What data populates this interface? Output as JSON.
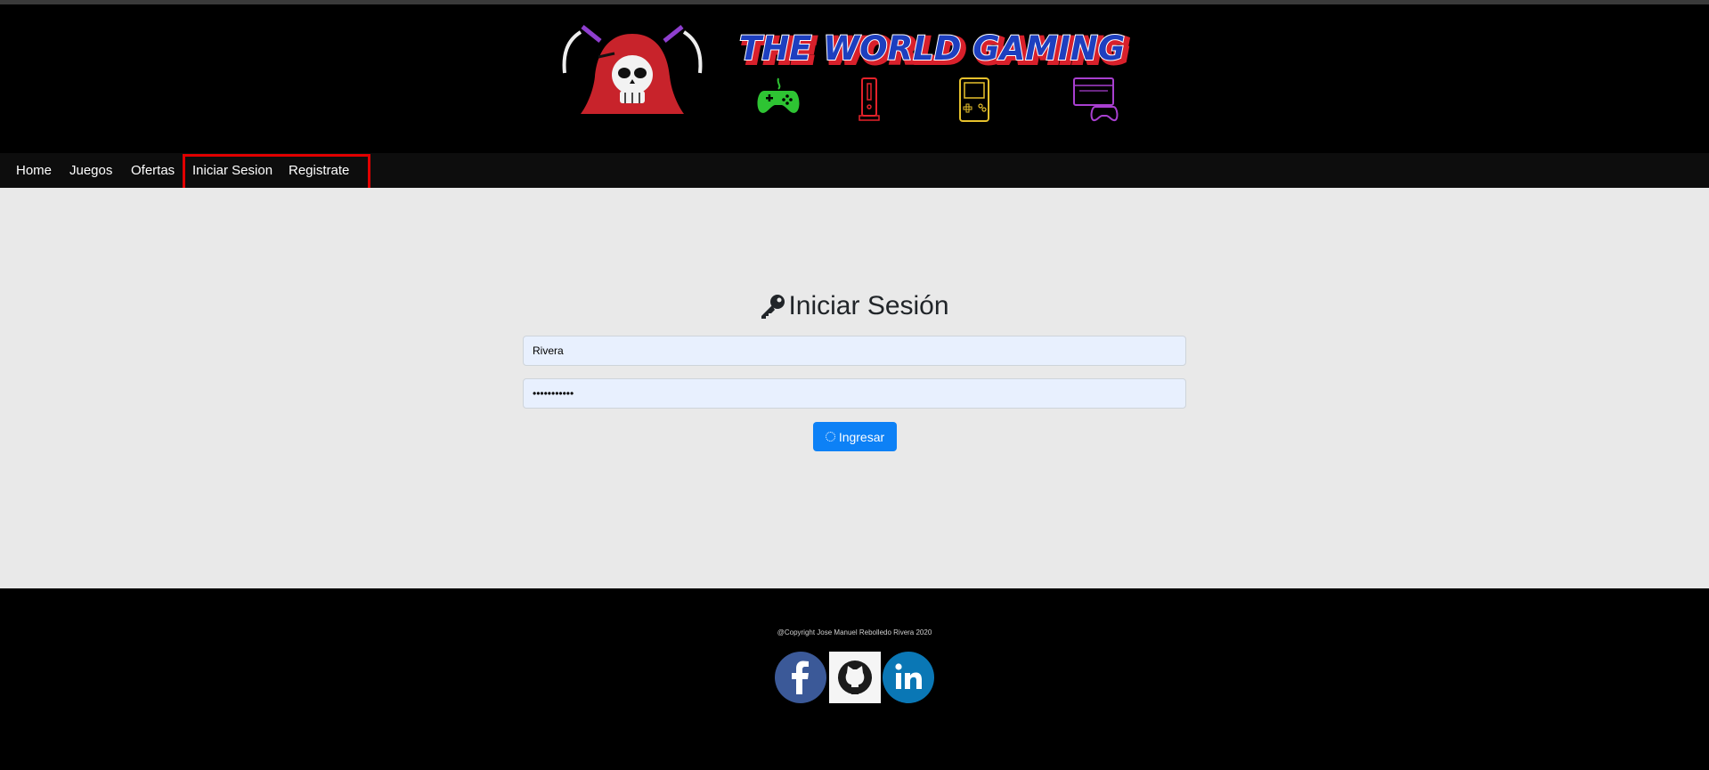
{
  "header": {
    "brand": "THE WORLD GAMING",
    "console_icons": [
      "gamepad-icon",
      "wii-console-icon",
      "gameboy-icon",
      "pc-console-icon"
    ]
  },
  "nav": {
    "items": [
      {
        "label": "Home"
      },
      {
        "label": "Juegos"
      },
      {
        "label": "Ofertas"
      },
      {
        "label": "Iniciar Sesion"
      },
      {
        "label": "Registrate"
      }
    ]
  },
  "login": {
    "title": "Iniciar Sesión",
    "username_value": "Rivera",
    "password_value": "contraseñas",
    "submit_label": "Ingresar"
  },
  "footer": {
    "copyright": "@Copyright Jose Manuel Rebolledo Rivera 2020",
    "social": [
      "facebook-icon",
      "github-icon",
      "linkedin-icon"
    ]
  },
  "colors": {
    "header_bg": "#000000",
    "main_bg": "#e9e9e9",
    "button": "#0d81f6",
    "highlight": "#e10000"
  }
}
